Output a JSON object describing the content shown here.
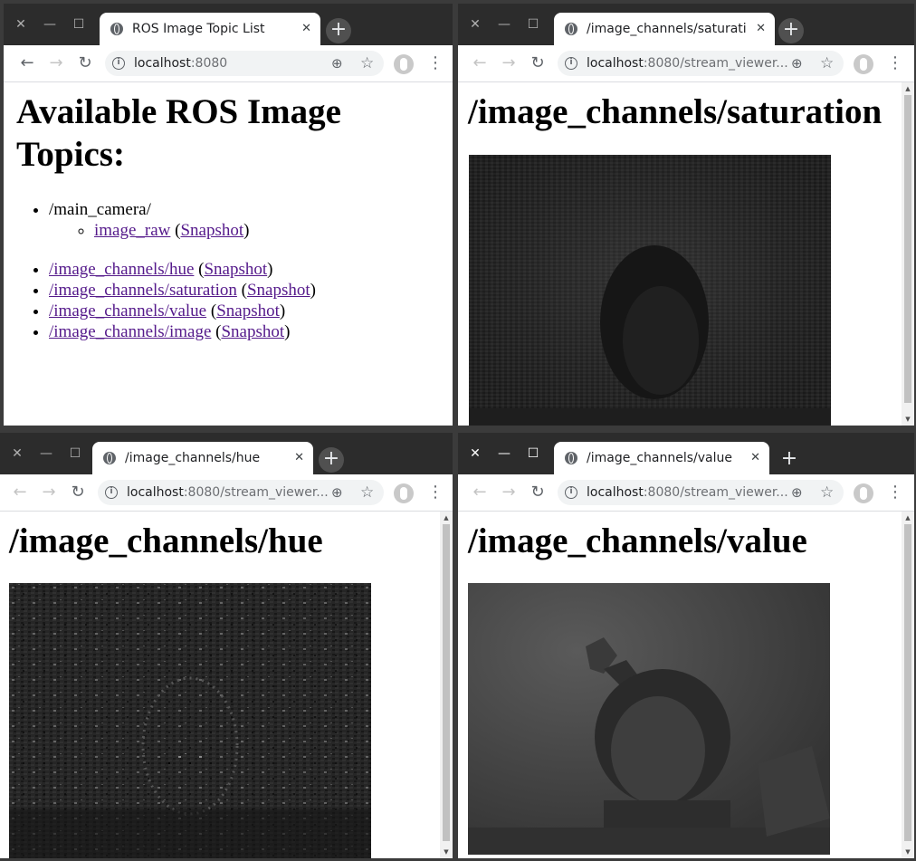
{
  "windows": [
    {
      "tab_title": "ROS Image Topic List",
      "url_host": "localhost",
      "url_rest": ":8080",
      "heading": "Available ROS Image Topics:",
      "topics": {
        "group_name": "/main_camera/",
        "group_items": [
          {
            "link": "image_raw",
            "snapshot": "Snapshot"
          }
        ],
        "items": [
          {
            "link": "/image_channels/hue",
            "snapshot": "Snapshot"
          },
          {
            "link": "/image_channels/saturation",
            "snapshot": "Snapshot"
          },
          {
            "link": "/image_channels/value",
            "snapshot": "Snapshot"
          },
          {
            "link": "/image_channels/image",
            "snapshot": "Snapshot"
          }
        ]
      }
    },
    {
      "tab_title": "/image_channels/saturati",
      "url_host": "localhost",
      "url_rest": ":8080/stream_viewer...",
      "heading": "/image_channels/saturation"
    },
    {
      "tab_title": "/image_channels/hue",
      "url_host": "localhost",
      "url_rest": ":8080/stream_viewer...",
      "heading": "/image_channels/hue"
    },
    {
      "tab_title": "/image_channels/value",
      "url_host": "localhost",
      "url_rest": ":8080/stream_viewer...",
      "heading": "/image_channels/value"
    }
  ],
  "icons": {
    "close": "✕",
    "minimize": "—",
    "maximize": "☐",
    "new_tab": "+",
    "back": "←",
    "forward": "→",
    "reload": "↻",
    "info": "i",
    "zoom": "⊕",
    "star": "☆",
    "menu": "⋮",
    "tab_close": "✕",
    "scroll_up": "▲",
    "scroll_down": "▼"
  },
  "punct": {
    "open": " (",
    "close": ")"
  }
}
